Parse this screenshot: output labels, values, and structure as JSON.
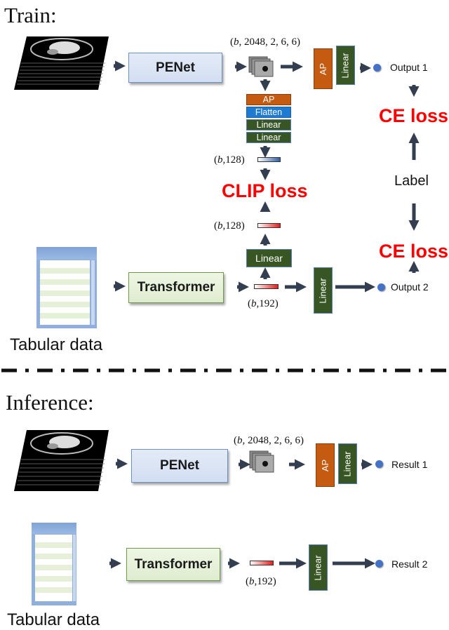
{
  "train": {
    "title": "Train:",
    "image_encoder": "PENet",
    "feature_dim": "2048, 2, 6, 6)",
    "feature_dim_prefix": "(",
    "batch_symbol": "b",
    "head_ap": "AP",
    "head_linear": "Linear",
    "projection_layers": [
      "AP",
      "Flatten",
      "Linear",
      "Linear"
    ],
    "image_embed_dim": ",128)",
    "tab_embed_dim": ",128)",
    "tab_feature_dim": ",192)",
    "clip_loss": "CLIP loss",
    "ce_loss_top": "CE loss",
    "ce_loss_bottom": "CE loss",
    "label": "Label",
    "output1": "Output 1",
    "output2": "Output 2",
    "tab_projection": "Linear",
    "tab_head": "Linear",
    "tab_encoder": "Transformer",
    "tab_caption": "Tabular data"
  },
  "inference": {
    "title": "Inference:",
    "image_encoder": "PENet",
    "feature_dim": "2048, 2, 6, 6)",
    "feature_dim_prefix": "(",
    "batch_symbol": "b",
    "head_ap": "AP",
    "head_linear": "Linear",
    "result1": "Result 1",
    "tab_encoder": "Transformer",
    "tab_feature_dim": ",192)",
    "tab_head": "Linear",
    "result2": "Result 2",
    "tab_caption": "Tabular data"
  },
  "colors": {
    "loss": "#ff0000",
    "ap": "#c55a11",
    "linear": "#375623",
    "flatten": "#1f7ad1",
    "output_dot": "#4472c4",
    "arrow": "#333f50"
  }
}
